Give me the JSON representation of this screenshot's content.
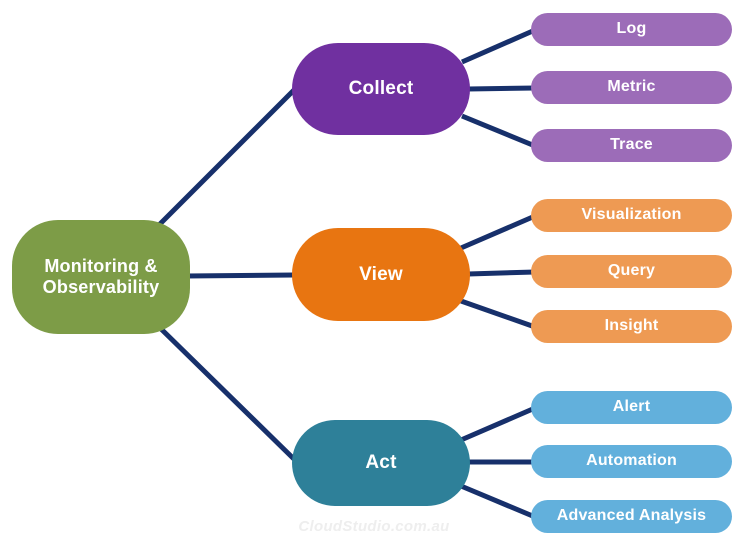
{
  "diagram": {
    "title": "Monitoring & Observability",
    "type": "mind-map",
    "watermark": "CloudStudio.com.au",
    "colors": {
      "root": "#7D9C47",
      "collect": "#7030A0",
      "collect_leaf": "#9C6CB8",
      "view": "#E87511",
      "view_leaf": "#EE9A53",
      "act": "#2E8099",
      "act_leaf": "#62B0DC",
      "connector": "#17306B",
      "label_text": "#FFFFFF",
      "background": "#FFFFFF",
      "watermark": "#EEEEEE"
    },
    "root": {
      "label": "Monitoring & Observability",
      "line1": "Monitoring &",
      "line2": "Observability"
    },
    "branches": [
      {
        "id": "collect",
        "label": "Collect",
        "leaves": [
          {
            "id": "log",
            "label": "Log"
          },
          {
            "id": "metric",
            "label": "Metric"
          },
          {
            "id": "trace",
            "label": "Trace"
          }
        ]
      },
      {
        "id": "view",
        "label": "View",
        "leaves": [
          {
            "id": "visualization",
            "label": "Visualization"
          },
          {
            "id": "query",
            "label": "Query"
          },
          {
            "id": "insight",
            "label": "Insight"
          }
        ]
      },
      {
        "id": "act",
        "label": "Act",
        "leaves": [
          {
            "id": "alert",
            "label": "Alert"
          },
          {
            "id": "automation",
            "label": "Automation"
          },
          {
            "id": "advanced-analysis",
            "label": "Advanced Analysis"
          }
        ]
      }
    ]
  }
}
